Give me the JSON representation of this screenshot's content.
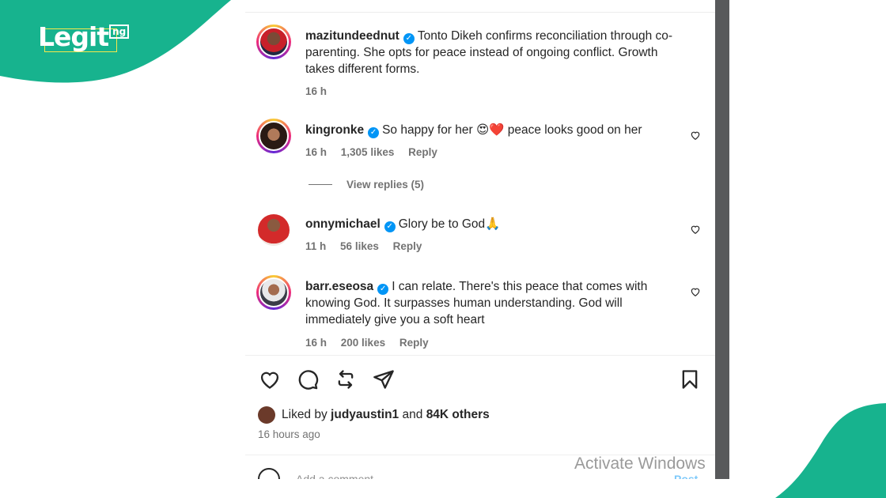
{
  "brand": {
    "logo_text": "Legit",
    "logo_tld": "ng",
    "green": "#17b38e"
  },
  "post": {
    "caption": {
      "username": "mazitundeednut",
      "text": "Tonto Dikeh confirms reconciliation through co-parenting. She opts for peace instead of ongoing conflict. Growth takes different forms.",
      "time": "16 h"
    },
    "comments": [
      {
        "username": "kingronke",
        "text": "So happy for her 😍❤️ peace looks good on her",
        "time": "16 h",
        "likes": "1,305 likes",
        "reply": "Reply"
      },
      {
        "username": "onnymichael",
        "text": "Glory be to God🙏",
        "time": "11 h",
        "likes": "56 likes",
        "reply": "Reply"
      },
      {
        "username": "barr.eseosa",
        "text": "I can relate. There's this peace that comes with knowing God. It surpasses human understanding. God will immediately give you a soft heart",
        "time": "16 h",
        "likes": "200 likes",
        "reply": "Reply"
      }
    ],
    "view_replies": "View replies (5)",
    "liked_by": {
      "prefix": "Liked by",
      "user": "judyaustin1",
      "and": "and",
      "others": "84K others"
    },
    "time_ago": "16 hours ago",
    "add_comment_placeholder": "Add a comment...",
    "post_label": "Post"
  },
  "os_watermark": "Activate Windows",
  "icons": [
    "heart-icon",
    "comment-icon",
    "share-icon",
    "send-icon",
    "bookmark-icon",
    "emoji-icon",
    "verified-icon"
  ]
}
